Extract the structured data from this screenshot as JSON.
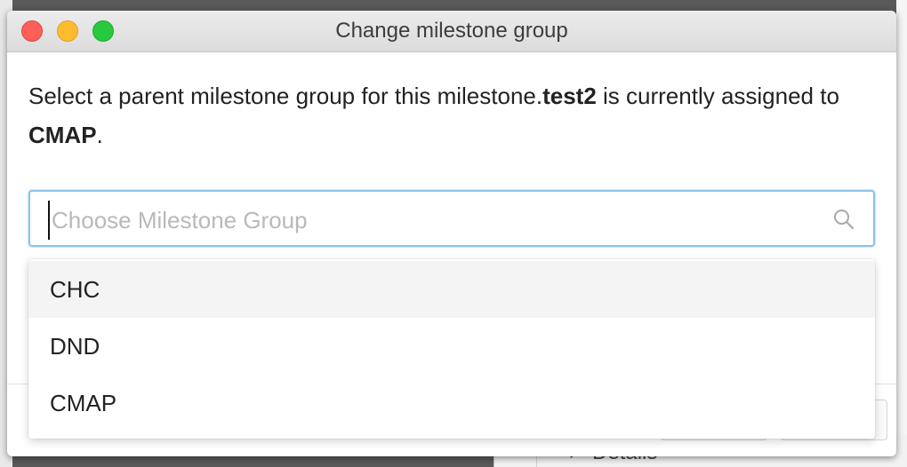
{
  "window": {
    "title": "Change milestone group"
  },
  "message": {
    "prefix": "Select a parent milestone group for this milestone.",
    "milestone_name": "test2",
    "middle": " is currently assigned to ",
    "current_group": "CMAP",
    "suffix": "."
  },
  "search": {
    "placeholder": "Choose Milestone Group",
    "value": "",
    "icon": "search-icon"
  },
  "dropdown": {
    "options": [
      "CHC",
      "DND",
      "CMAP"
    ],
    "highlighted_index": 0
  },
  "background": {
    "details_label": "Details"
  },
  "colors": {
    "focus_border": "#8cc3ec",
    "close": "#fc5f57",
    "minimize": "#fdbc2e",
    "maximize": "#28c840",
    "highlight": "#f4f4f4"
  }
}
